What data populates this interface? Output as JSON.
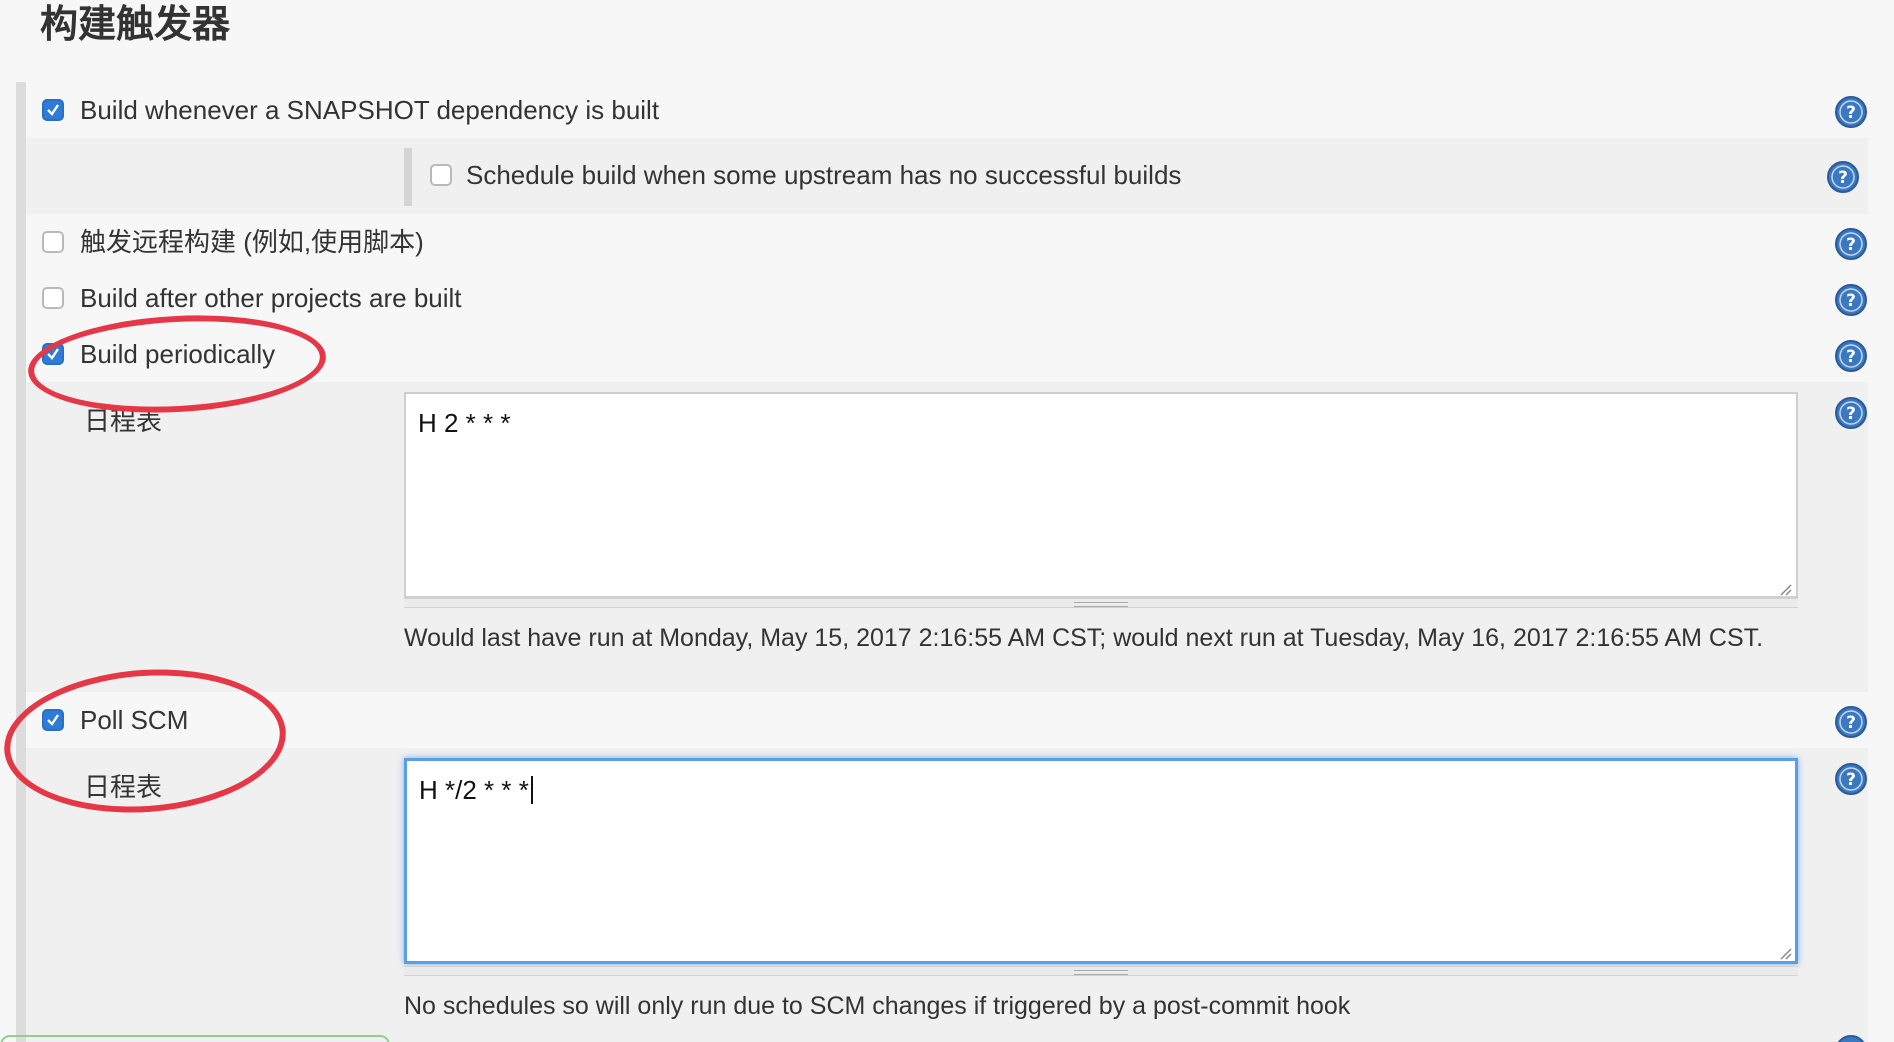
{
  "section": {
    "title": "构建触发器"
  },
  "triggers": {
    "snapshot": {
      "label": "Build whenever a SNAPSHOT dependency is built",
      "checked": true
    },
    "upstream_no_success": {
      "label": "Schedule build when some upstream has no successful builds",
      "checked": false
    },
    "remote": {
      "label": "触发远程构建 (例如,使用脚本)",
      "checked": false
    },
    "after_other": {
      "label": "Build after other projects are built",
      "checked": false
    },
    "periodic": {
      "label": "Build periodically",
      "checked": true,
      "schedule_label": "日程表",
      "schedule_value": "H 2 * * *",
      "info": "Would last have run at Monday, May 15, 2017 2:16:55 AM CST; would next run at Tuesday, May 16, 2017 2:16:55 AM CST."
    },
    "poll_scm": {
      "label": "Poll SCM",
      "checked": true,
      "schedule_label": "日程表",
      "schedule_value": "H */2 * * *",
      "info": "No schedules so will only run due to SCM changes if triggered by a post-commit hook"
    }
  },
  "icons": {
    "help": "help-icon",
    "checkmark": "checkmark-icon"
  },
  "colors": {
    "checkbox_blue": "#2f7bd8",
    "help_blue": "#3b78c2",
    "annotation_red": "#e63747",
    "focus_blue": "#5a9ee8"
  }
}
